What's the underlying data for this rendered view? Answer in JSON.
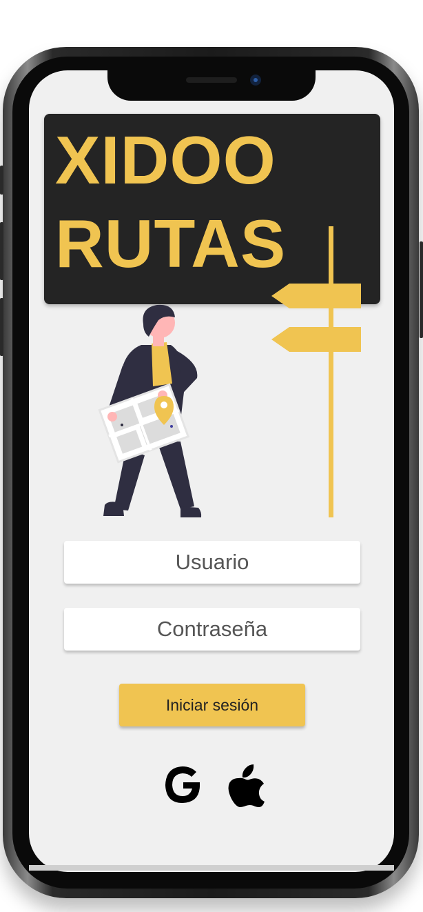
{
  "app": {
    "title_line1": "XIDOO",
    "title_line2": "RUTAS"
  },
  "form": {
    "username_placeholder": "Usuario",
    "password_placeholder": "Contraseña",
    "login_label": "Iniciar sesión"
  },
  "social": [
    {
      "icon": "google-icon"
    },
    {
      "icon": "apple-icon"
    }
  ],
  "colors": {
    "accent": "#f0c451",
    "banner": "#242424",
    "screen_bg": "#f0f0f0",
    "person_dark": "#2f2e41",
    "skin": "#ffb6b6"
  }
}
